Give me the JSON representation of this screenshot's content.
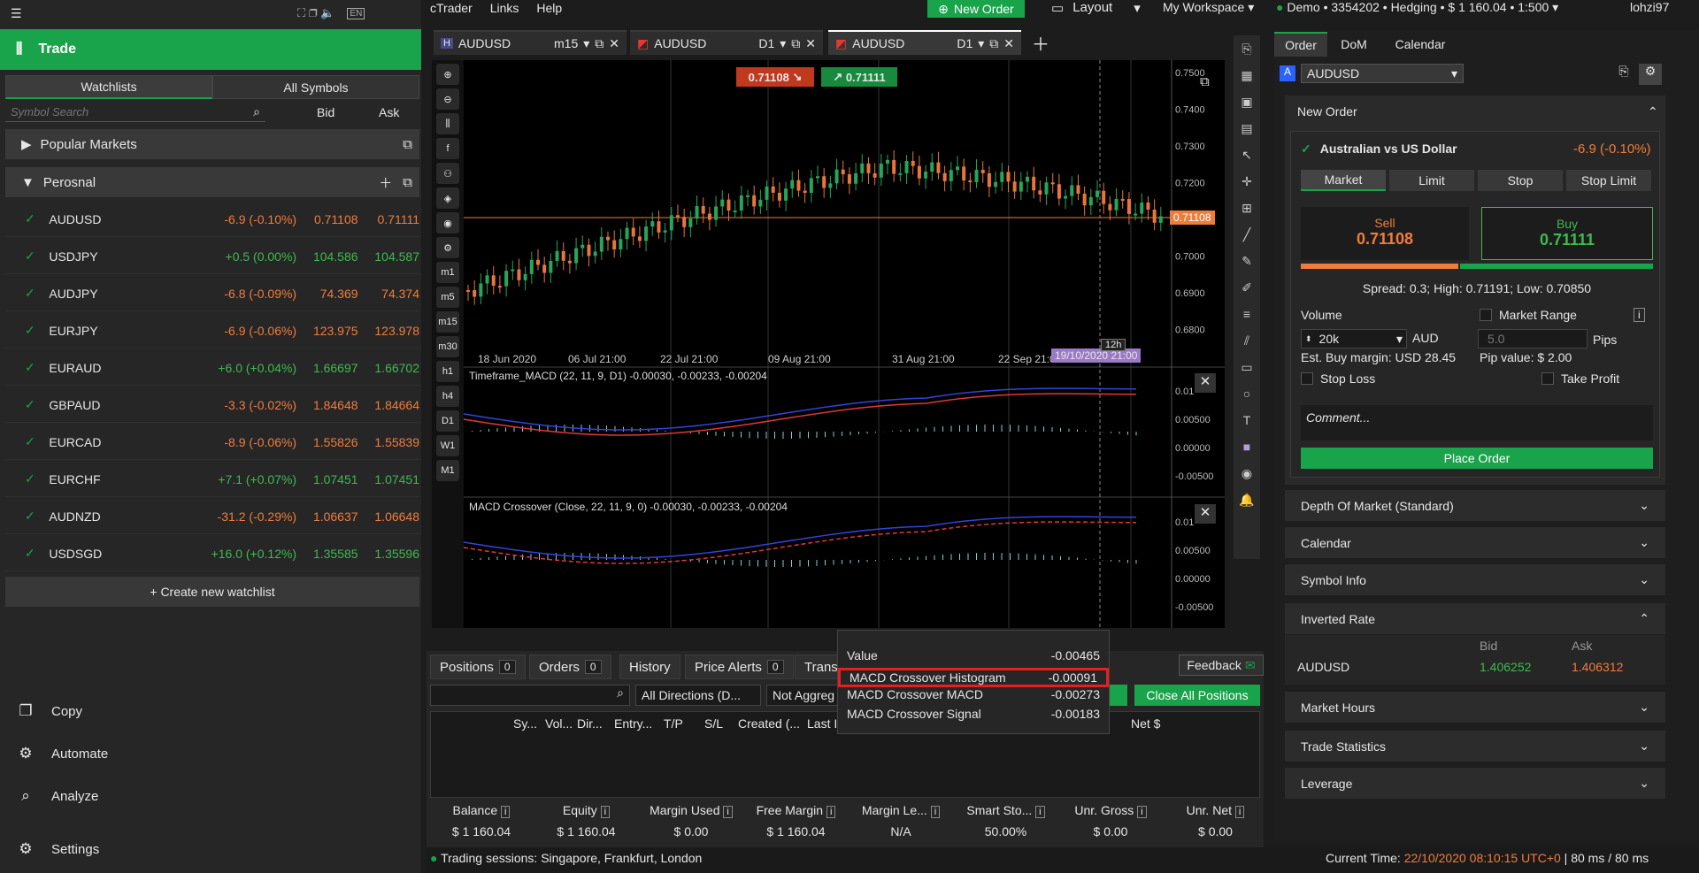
{
  "app": {
    "menu": [
      "cTrader",
      "Links",
      "Help"
    ],
    "new_order": "New Order",
    "layout": "Layout",
    "workspace": "My Workspace",
    "account": "Demo • 3354202 • Hedging • $ 1 160.04 • 1:500",
    "user": "lohzi97",
    "lang": "EN"
  },
  "left": {
    "title": "Trade",
    "tabs": [
      "Watchlists",
      "All Symbols"
    ],
    "search_placeholder": "Symbol Search",
    "bid_label": "Bid",
    "ask_label": "Ask",
    "popular": "Popular Markets",
    "personal": "Perosnal",
    "rows": [
      {
        "sym": "AUDUSD",
        "chg": "-6.9 (-0.10%)",
        "bid": "0.71108",
        "ask": "0.71111",
        "neg": true
      },
      {
        "sym": "USDJPY",
        "chg": "+0.5 (0.00%)",
        "bid": "104.586",
        "ask": "104.587",
        "neg": false
      },
      {
        "sym": "AUDJPY",
        "chg": "-6.8 (-0.09%)",
        "bid": "74.369",
        "ask": "74.374",
        "neg": true
      },
      {
        "sym": "EURJPY",
        "chg": "-6.9 (-0.06%)",
        "bid": "123.975",
        "ask": "123.978",
        "neg": true
      },
      {
        "sym": "EURAUD",
        "chg": "+6.0 (+0.04%)",
        "bid": "1.66697",
        "ask": "1.66702",
        "neg": false
      },
      {
        "sym": "GBPAUD",
        "chg": "-3.3 (-0.02%)",
        "bid": "1.84648",
        "ask": "1.84664",
        "neg": true
      },
      {
        "sym": "EURCAD",
        "chg": "-8.9 (-0.06%)",
        "bid": "1.55826",
        "ask": "1.55839",
        "neg": true
      },
      {
        "sym": "EURCHF",
        "chg": "+7.1 (+0.07%)",
        "bid": "1.07451",
        "ask": "1.07451",
        "neg": false
      },
      {
        "sym": "AUDNZD",
        "chg": "-31.2 (-0.29%)",
        "bid": "1.06637",
        "ask": "1.06648",
        "neg": true
      },
      {
        "sym": "USDSGD",
        "chg": "+16.0 (+0.12%)",
        "bid": "1.35585",
        "ask": "1.35596",
        "neg": false
      }
    ],
    "create": "+ Create new watchlist",
    "nav": [
      "Copy",
      "Automate",
      "Analyze",
      "Settings"
    ]
  },
  "tabs": [
    {
      "sym": "AUDUSD",
      "tf": "m15"
    },
    {
      "sym": "AUDUSD",
      "tf": "D1"
    },
    {
      "sym": "AUDUSD",
      "tf": "D1"
    }
  ],
  "chart": {
    "sell": "0.71108",
    "buy": "0.71111",
    "price_tag": "0.71108",
    "ticks": [
      "0.7500",
      "0.7400",
      "0.7300",
      "0.7200",
      "0.7100",
      "0.7000",
      "0.6900",
      "0.6800"
    ],
    "dates": [
      "18 Jun 2020",
      "06 Jul 21:00",
      "22 Jul 21:00",
      "09 Aug 21:00",
      "31 Aug 21:00",
      "22 Sep 21:00"
    ],
    "cursor_date": "19/10/2020 21:00",
    "cursor_tf": "12h",
    "ind1": "Timeframe_MACD (22, 11, 9, D1) -0.00030, -0.00233, -0.00204",
    "ind2": "MACD Crossover (Close, 22, 11, 9, 0) -0.00030, -0.00233, -0.00204",
    "ind_ticks": [
      "0.01",
      "0.00500",
      "0.00000",
      "-0.00500"
    ],
    "timeframes": [
      "m1",
      "m5",
      "m15",
      "m30",
      "h1",
      "h4",
      "D1",
      "W1",
      "M1"
    ]
  },
  "tooltip": {
    "rows": [
      [
        "Value",
        "-0.00465"
      ],
      [
        "MACD Crossover Histogram",
        "-0.00091"
      ],
      [
        "MACD Crossover MACD",
        "-0.00273"
      ],
      [
        "MACD Crossover Signal",
        "-0.00183"
      ]
    ]
  },
  "bottom": {
    "tabs": [
      [
        "Positions",
        "0"
      ],
      [
        "Orders",
        "0"
      ],
      [
        "History",
        ""
      ],
      [
        "Price Alerts",
        "0"
      ],
      [
        "Trans",
        ""
      ]
    ],
    "feedback": "Feedback",
    "filter": "All Directions (D...",
    "agg": "Not Aggreg",
    "close_all": "Close All Positions",
    "cols": [
      "Sy...",
      "Vol...",
      "Dir...",
      "Entry...",
      "T/P",
      "S/L",
      "Created (...",
      "Last I",
      "Net $"
    ],
    "stats": [
      [
        "Balance",
        "$ 1 160.04"
      ],
      [
        "Equity",
        "$ 1 160.04"
      ],
      [
        "Margin Used",
        "$ 0.00"
      ],
      [
        "Free Margin",
        "$ 1 160.04"
      ],
      [
        "Margin Le...",
        "N/A"
      ],
      [
        "Smart Sto...",
        "50.00%"
      ],
      [
        "Unr. Gross",
        "$ 0.00"
      ],
      [
        "Unr. Net",
        "$ 0.00"
      ]
    ]
  },
  "status": {
    "sessions": "Trading sessions: Singapore, Frankfurt, London",
    "time_label": "Current Time:",
    "time": "22/10/2020 08:10:15",
    "tz": "UTC+0",
    "ping": "80 ms / 80 ms"
  },
  "right": {
    "tabs": [
      "Order",
      "DoM",
      "Calendar"
    ],
    "symbol": "AUDUSD",
    "new_order": "New Order",
    "name": "Australian vs US Dollar",
    "chg": "-6.9 (-0.10%)",
    "types": [
      "Market",
      "Limit",
      "Stop",
      "Stop Limit"
    ],
    "sell": "Sell",
    "sell_px": "0.71108",
    "buy": "Buy",
    "buy_px": "0.71111",
    "spread": "Spread: 0.3; High: 0.71191; Low: 0.70850",
    "volume": "Volume",
    "vol_val": "20k",
    "ccy": "AUD",
    "range": "Market Range",
    "pips_val": "5.0",
    "pips": "Pips",
    "margin": "Est. Buy margin: USD 28.45",
    "pipval": "Pip value: $ 2.00",
    "sl": "Stop Loss",
    "tp": "Take Profit",
    "comment": "Comment...",
    "place": "Place Order",
    "panels": [
      "Depth Of Market (Standard)",
      "Calendar",
      "Symbol Info",
      "Inverted Rate",
      "Market Hours",
      "Trade Statistics",
      "Leverage"
    ],
    "inv_bid_label": "Bid",
    "inv_ask_label": "Ask",
    "inv_sym": "AUDUSD",
    "inv_bid": "1.406252",
    "inv_ask": "1.406312"
  },
  "colors": {
    "green": "#19a34a",
    "orange": "#f07c3c",
    "red": "#e62020"
  }
}
